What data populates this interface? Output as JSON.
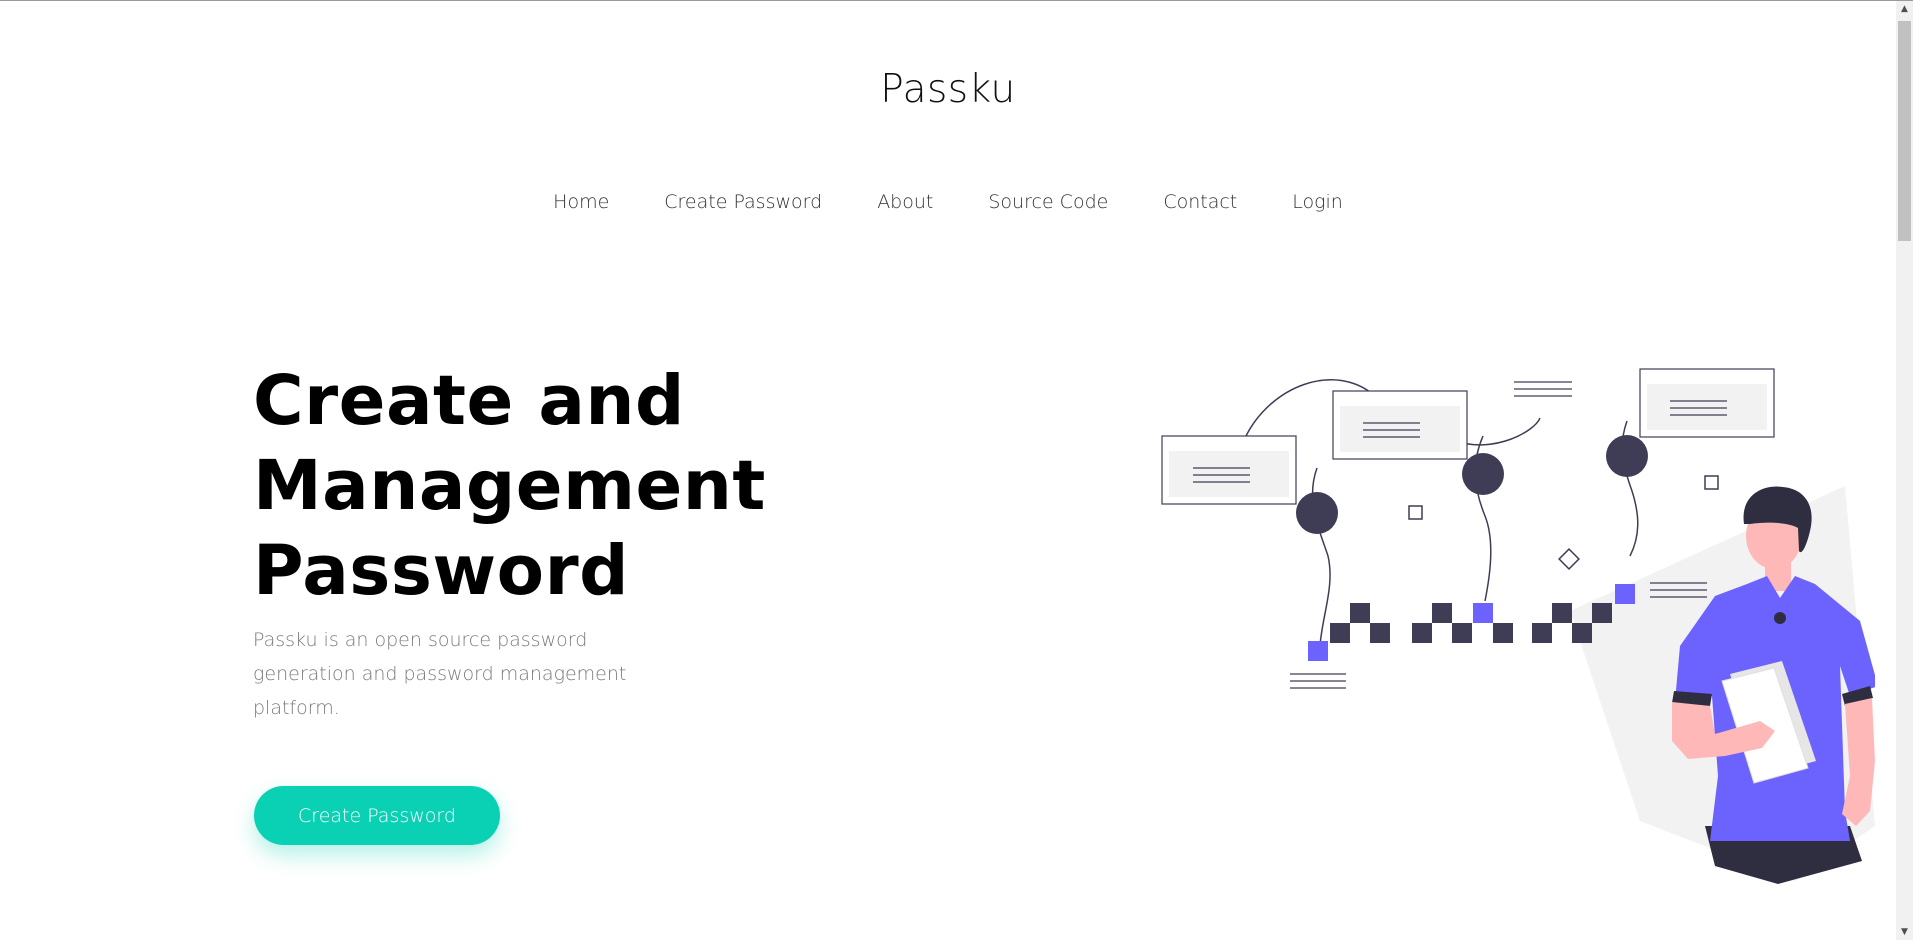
{
  "header": {
    "brand": "Passku"
  },
  "nav": {
    "items": [
      {
        "label": "Home"
      },
      {
        "label": "Create Password"
      },
      {
        "label": "About"
      },
      {
        "label": "Source Code"
      },
      {
        "label": "Contact"
      },
      {
        "label": "Login"
      }
    ]
  },
  "hero": {
    "title_lines": [
      "Create and",
      "Management",
      "Password"
    ],
    "description": "Passku is an open source password generation and password management platform.",
    "cta_label": "Create Password"
  },
  "colors": {
    "accent": "#0bd1b4",
    "illustration_primary": "#6c63ff",
    "illustration_dark": "#3f3d56",
    "skin": "#ffb8b8"
  },
  "icons": {
    "scroll_up": "triangle-up",
    "scroll_down": "triangle-down"
  }
}
